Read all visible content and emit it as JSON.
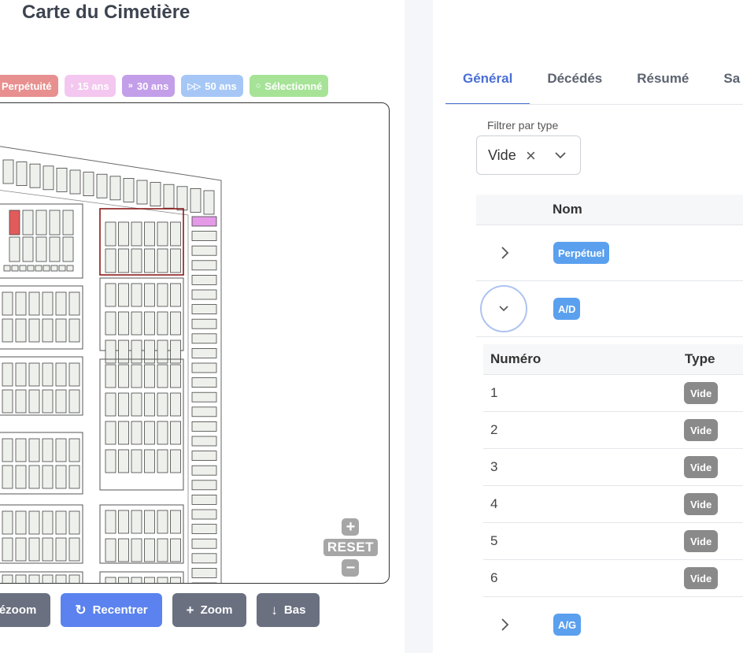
{
  "title": "Carte du Cimetière",
  "legend": [
    {
      "label": "Perpétuité",
      "color": "#e88f8f"
    },
    {
      "label": "15 ans",
      "icon": "chevron-right-icon",
      "color": "#f3c7ef"
    },
    {
      "label": "30 ans",
      "icon": "double-chevron-icon",
      "color": "#c39ee9"
    },
    {
      "label": "50 ans",
      "icon": "fast-forward-icon",
      "color": "#a6c7f6"
    },
    {
      "label": "Sélectionné",
      "icon": "circle-icon",
      "color": "#a6e397"
    }
  ],
  "map": {
    "zoom_in": "+",
    "reset": "RESET",
    "zoom_out": "−"
  },
  "buttons": {
    "dezoom": "Dézoom",
    "recentrer": "Recentrer",
    "zoom": "Zoom",
    "bas": "Bas"
  },
  "tabs": [
    "Général",
    "Décédés",
    "Résumé",
    "Sa"
  ],
  "filter": {
    "label": "Filtrer par type",
    "value": "Vide"
  },
  "table": {
    "header": "Nom",
    "groups": [
      {
        "tag": "Perpétuel",
        "expanded": false
      },
      {
        "tag": "A/D",
        "expanded": true
      },
      {
        "tag": "A/G",
        "expanded": false
      }
    ],
    "sub_headers": [
      "Numéro",
      "Type"
    ],
    "sub_rows": [
      {
        "num": "1",
        "type": "Vide"
      },
      {
        "num": "2",
        "type": "Vide"
      },
      {
        "num": "3",
        "type": "Vide"
      },
      {
        "num": "4",
        "type": "Vide"
      },
      {
        "num": "5",
        "type": "Vide"
      },
      {
        "num": "6",
        "type": "Vide"
      }
    ]
  },
  "colors": {
    "accent": "#4a6fd4",
    "tag_blue": "#5aa0ee",
    "tag_gray": "#8a8a8a",
    "highlight_red": "#e25b5b",
    "highlight_pink": "#e59ae8",
    "selected_outline": "#8b1a1a"
  }
}
